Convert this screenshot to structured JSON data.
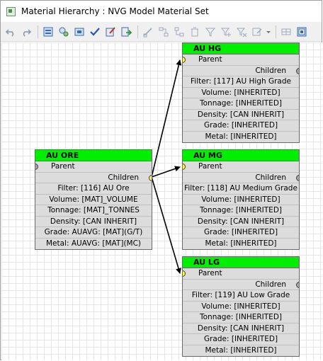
{
  "window": {
    "title": "Material Hierarchy : NVG Model Material Set"
  },
  "toolbar": {
    "icons": [
      "undo-icon",
      "redo-icon",
      "properties-icon",
      "refresh-icon",
      "layout-icon",
      "check-icon",
      "edit-icon",
      "export-icon",
      "select-icon",
      "connect-icon",
      "disconnect-icon",
      "delete-icon",
      "filter-icon",
      "filter-add-icon",
      "filter-remove-icon",
      "filter-edit-icon",
      "dropdown-icon",
      "grid-icon",
      "zoom-icon",
      "close-panel-icon"
    ]
  },
  "colors": {
    "header": "#00ee00",
    "row": "#dcdcdc",
    "link": "#000000",
    "port_active": "#ffff33",
    "port_inactive": "#a8a8a8"
  },
  "nodes": [
    {
      "id": "au_ore",
      "title": "AU ORE",
      "parent_label": "Parent",
      "children_label": "Children",
      "fields": [
        "Filter: [116] AU Ore",
        "Volume: [MAT]_VOLUME",
        "Tonnage: [MAT]_TONNES",
        "Density: [CAN INHERIT]",
        "Grade: AUAVG: [MAT](G/T)",
        "Metal: AUAVG: [MAT](MC)"
      ]
    },
    {
      "id": "au_hg",
      "title": "AU HG",
      "parent_label": "Parent",
      "children_label": "Children",
      "fields": [
        "Filter: [117] AU High Grade",
        "Volume: [INHERITED]",
        "Tonnage: [INHERITED]",
        "Density: [CAN INHERIT]",
        "Grade: [INHERITED]",
        "Metal: [INHERITED]"
      ]
    },
    {
      "id": "au_mg",
      "title": "AU MG",
      "parent_label": "Parent",
      "children_label": "Children",
      "fields": [
        "Filter: [118] AU Medium Grade",
        "Volume: [INHERITED]",
        "Tonnage: [INHERITED]",
        "Density: [CAN INHERIT]",
        "Grade: [INHERITED]",
        "Metal: [INHERITED]"
      ]
    },
    {
      "id": "au_lg",
      "title": "AU LG",
      "parent_label": "Parent",
      "children_label": "Children",
      "fields": [
        "Filter: [119] AU Low Grade",
        "Volume: [INHERITED]",
        "Tonnage: [INHERITED]",
        "Density: [CAN INHERIT]",
        "Grade: [INHERITED]",
        "Metal: [INHERITED]"
      ]
    }
  ]
}
